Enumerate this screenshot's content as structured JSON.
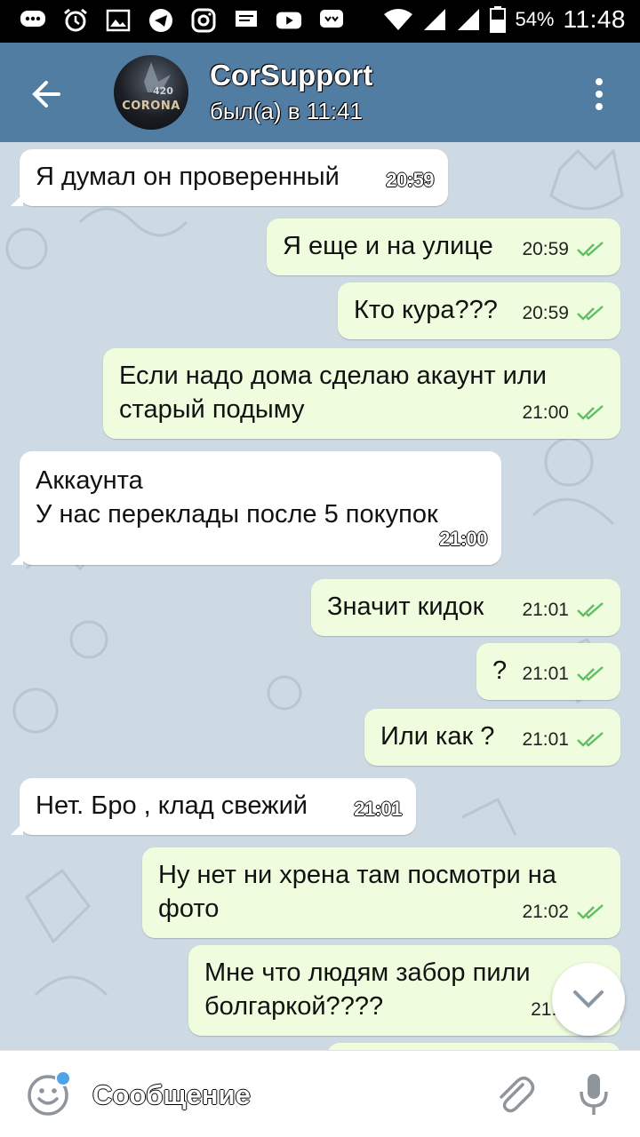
{
  "status_bar": {
    "battery": "54%",
    "time": "11:48"
  },
  "header": {
    "title": "CorSupport",
    "subtitle": "был(а) в 11:41",
    "avatar": {
      "text": "CORONA",
      "number": "420"
    }
  },
  "messages": [
    {
      "dir": "in",
      "text": "Я думал он проверенный",
      "time": "20:59"
    },
    {
      "dir": "out",
      "text": "Я еще и на улице",
      "time": "20:59"
    },
    {
      "dir": "out",
      "text": "Кто кура???",
      "time": "20:59"
    },
    {
      "dir": "out",
      "text": "Если надо дома сделаю акаунт  или\nстарый подыму",
      "time": "21:00"
    },
    {
      "dir": "in",
      "text": "Аккаунта\nУ нас переклады после 5 покупок",
      "time": "21:00"
    },
    {
      "dir": "out",
      "text": "Значит кидок",
      "time": "21:01"
    },
    {
      "dir": "out",
      "text": "?",
      "time": "21:01"
    },
    {
      "dir": "out",
      "text": "Или как ?",
      "time": "21:01"
    },
    {
      "dir": "in",
      "text": "Нет. Бро , клад свежий",
      "time": "21:01"
    },
    {
      "dir": "out",
      "text": "Ну нет ни хрена там посмотри на\nфото",
      "time": "21:02"
    },
    {
      "dir": "out",
      "text": "Мне что людям забор пили\nболгаркой????",
      "time": "21:0"
    }
  ],
  "composer": {
    "placeholder": "Сообщение"
  },
  "colors": {
    "app_bar": "#527da3",
    "chat_bg": "#cdd9e3",
    "outgoing_bubble": "#effdde",
    "incoming_bubble": "#ffffff",
    "read_checks": "#5fbf64"
  },
  "icons": {
    "back": "arrow-left-icon",
    "menu": "more-vertical-icon",
    "emoji": "smile-icon",
    "attach": "paperclip-icon",
    "mic": "microphone-icon",
    "scroll_down": "chevron-down-icon",
    "read": "double-check-icon"
  }
}
